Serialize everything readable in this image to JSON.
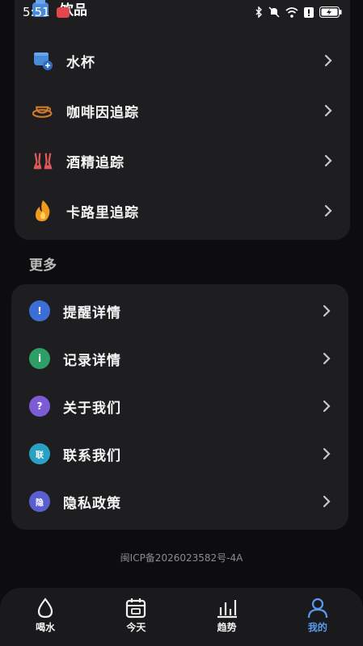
{
  "status_bar": {
    "time": "5:51"
  },
  "drinks_section": {
    "title": "饮品",
    "items": [
      {
        "label": "水杯",
        "icon": "water-cup-icon"
      },
      {
        "label": "咖啡因追踪",
        "icon": "coffee-icon"
      },
      {
        "label": "酒精追踪",
        "icon": "alcohol-icon"
      },
      {
        "label": "卡路里追踪",
        "icon": "flame-icon"
      }
    ]
  },
  "more_section": {
    "title": "更多",
    "items": [
      {
        "label": "提醒详情",
        "badge": "!",
        "color": "#3b6fd6"
      },
      {
        "label": "记录详情",
        "badge": "i",
        "color": "#2e9e67"
      },
      {
        "label": "关于我们",
        "badge": "?",
        "color": "#7b5bd6"
      },
      {
        "label": "联系我们",
        "badge": "联",
        "color": "#2aa1c4"
      },
      {
        "label": "隐私政策",
        "badge": "隐",
        "color": "#5a5fcf"
      }
    ]
  },
  "footer": {
    "icp": "闽ICP备2026023582号-4A"
  },
  "tabbar": {
    "tabs": [
      {
        "label": "喝水",
        "icon": "water-drop-icon",
        "active": false
      },
      {
        "label": "今天",
        "icon": "calendar-icon",
        "active": false
      },
      {
        "label": "趋势",
        "icon": "bar-chart-icon",
        "active": false
      },
      {
        "label": "我的",
        "icon": "profile-icon",
        "active": true
      }
    ],
    "active_color": "#5a9af0"
  }
}
